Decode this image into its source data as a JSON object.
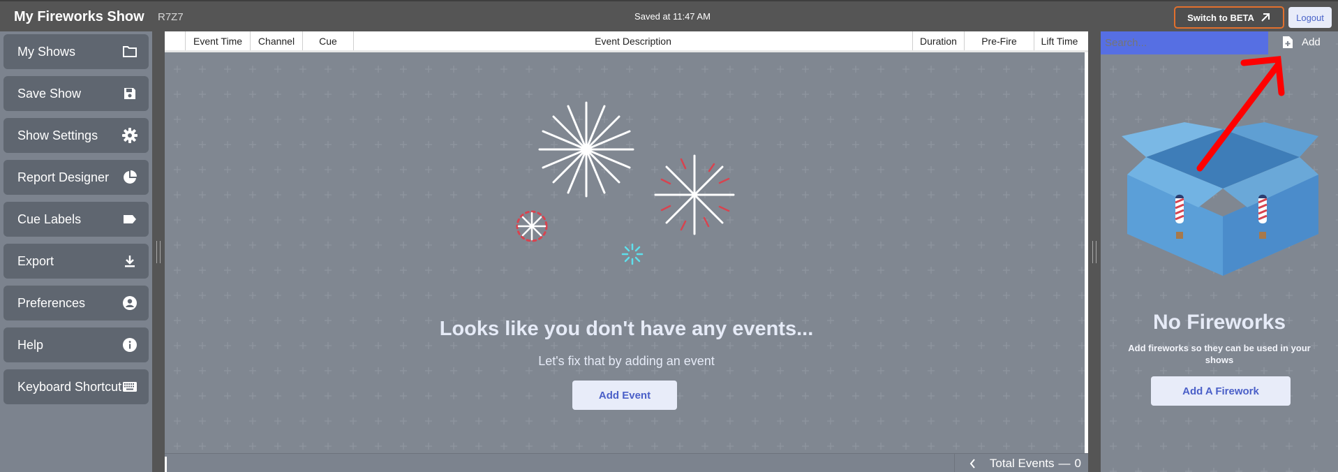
{
  "header": {
    "app_title": "My Fireworks Show",
    "show_code": "R7Z7",
    "saved_status": "Saved at 11:47 AM",
    "beta_button": "Switch to BETA",
    "logout_button": "Logout"
  },
  "sidebar": {
    "items": [
      {
        "label": "My Shows",
        "icon": "folder-icon"
      },
      {
        "label": "Save Show",
        "icon": "save-icon"
      },
      {
        "label": "Show Settings",
        "icon": "gear-icon"
      },
      {
        "label": "Report Designer",
        "icon": "pie-chart-icon"
      },
      {
        "label": "Cue Labels",
        "icon": "label-tag-icon"
      },
      {
        "label": "Export",
        "icon": "download-icon"
      },
      {
        "label": "Preferences",
        "icon": "user-circle-icon"
      },
      {
        "label": "Help",
        "icon": "info-icon"
      },
      {
        "label": "Keyboard Shortcuts",
        "icon": "keyboard-icon"
      }
    ]
  },
  "events_table": {
    "columns": [
      "",
      "Event Time",
      "Channel",
      "Cue",
      "Event Description",
      "Duration",
      "Pre-Fire",
      "Lift Time"
    ]
  },
  "empty_state": {
    "title": "Looks like you don't have any events...",
    "subtitle": "Let's fix that by adding an event",
    "button": "Add Event"
  },
  "footer": {
    "total_label": "Total Events",
    "total_count": "0"
  },
  "fireworks_panel": {
    "search_placeholder": "Search...",
    "add_label": "Add",
    "empty_title": "No Fireworks",
    "empty_subtitle": "Add fireworks so they can be used in your shows",
    "button": "Add A Firework"
  },
  "colors": {
    "topbar": "#555555",
    "sidebar_item": "#5f6670",
    "background": "#808791",
    "accent_blue": "#566fe3",
    "beta_border": "#e2702d",
    "arrow": "#ff0000",
    "box": "#6aa8d8"
  }
}
